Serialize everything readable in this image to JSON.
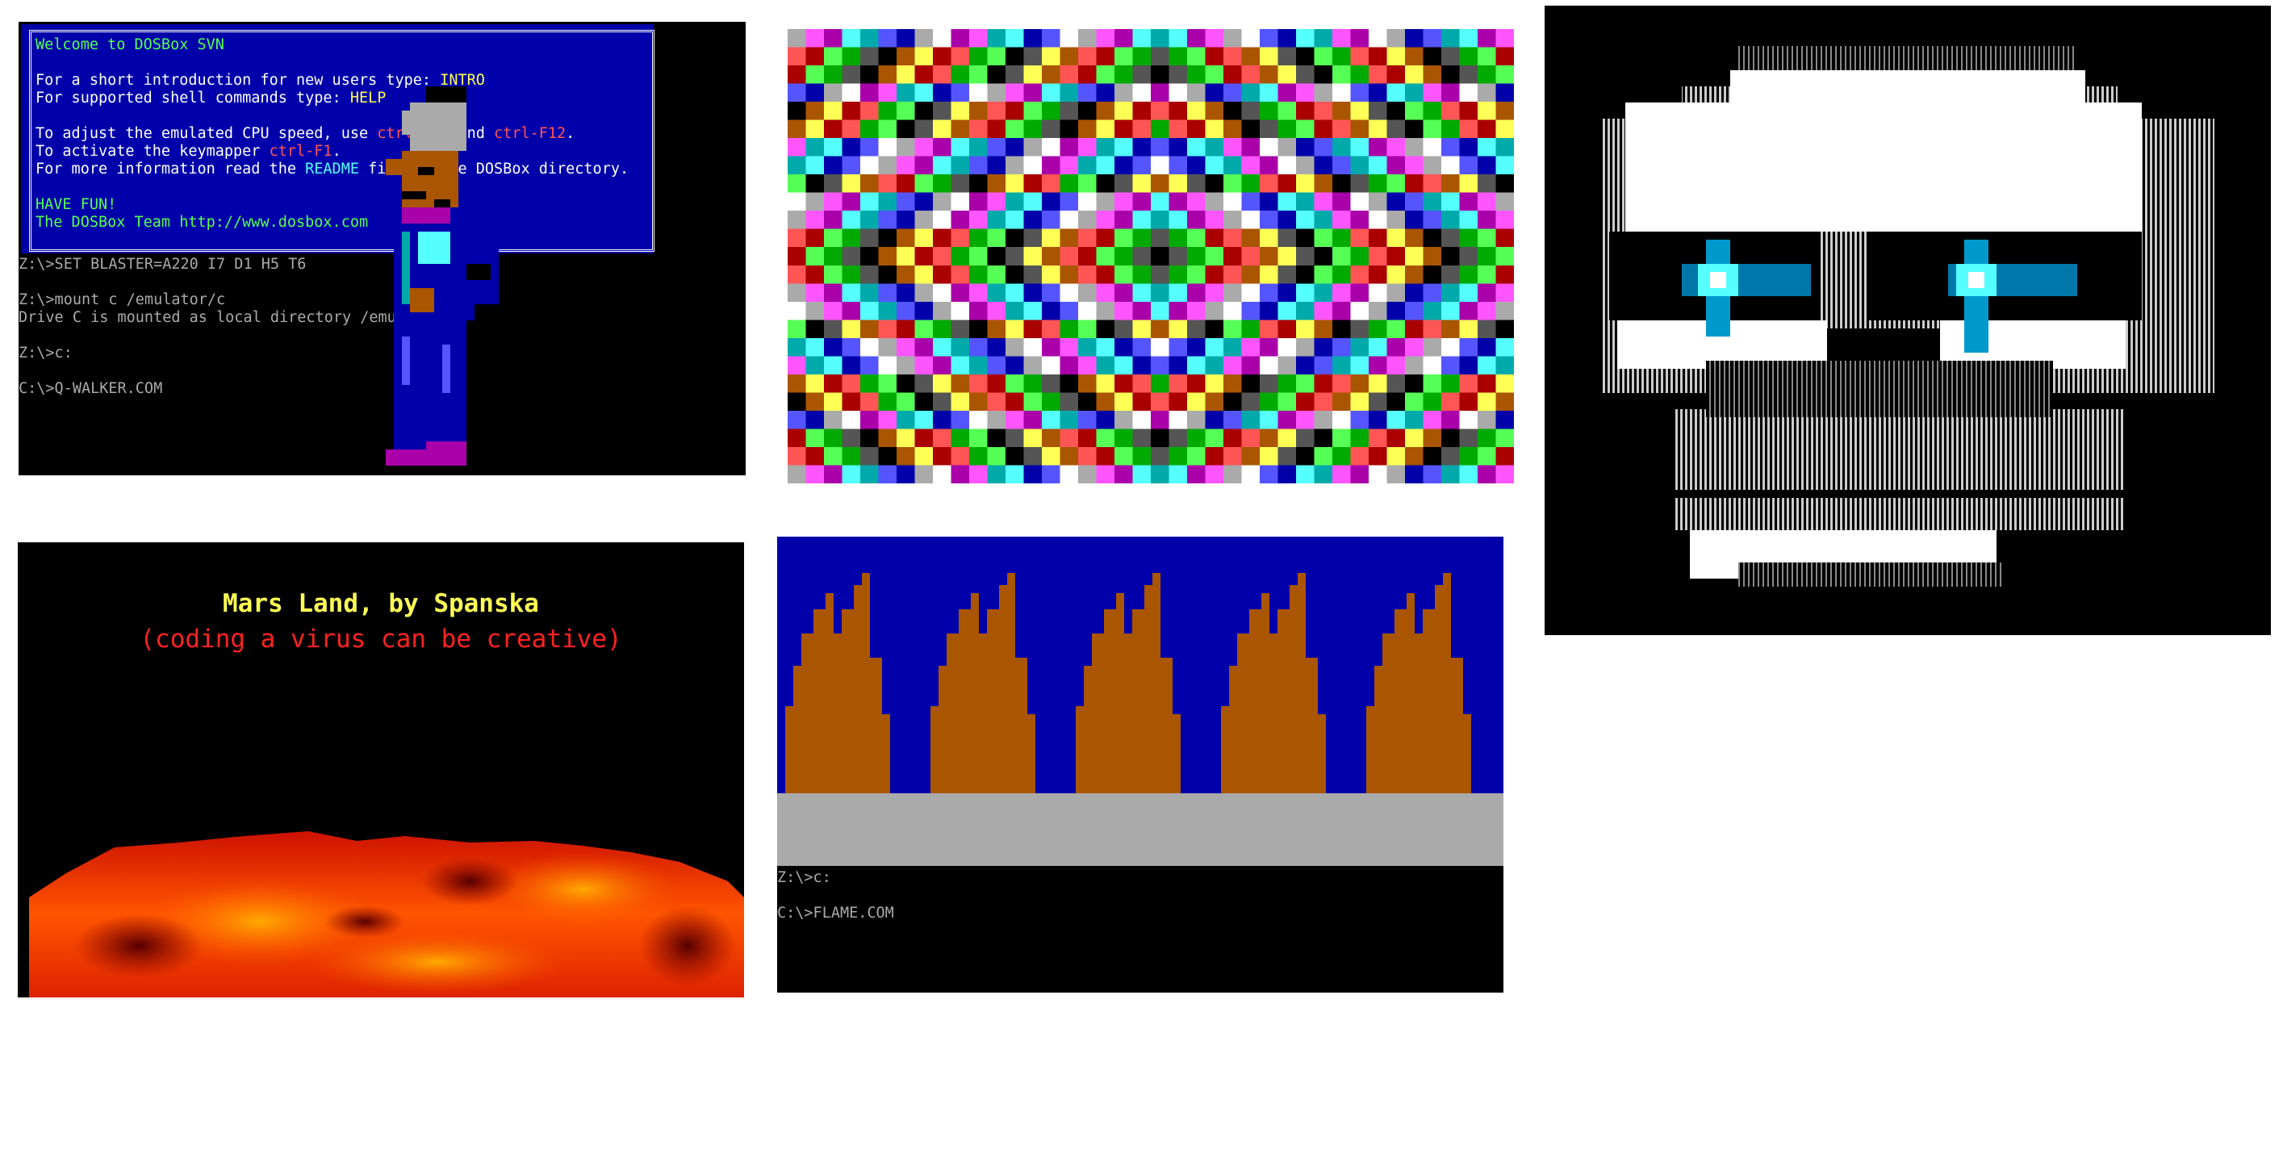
{
  "panels": {
    "dosbox": {
      "banner_lines": [
        [
          "Welcome to DOSBox SVN"
        ],
        [
          ""
        ],
        [
          "For a short introduction for new users type: ",
          "INTRO"
        ],
        [
          "For supported shell commands type: ",
          "HELP"
        ],
        [
          ""
        ],
        [
          "To adjust the emulated CPU speed, use ",
          "ctrl-F11",
          " and ",
          "ctrl-F12",
          "."
        ],
        [
          "To activate the keymapper ",
          "ctrl-F1",
          "."
        ],
        [
          "For more information read the ",
          "README",
          " file in the DOSBox directory."
        ],
        [
          ""
        ],
        [
          "HAVE FUN!"
        ],
        [
          "The DOSBox Team http://www.dosbox.com"
        ]
      ],
      "shell_lines": [
        "Z:\\>SET BLASTER=A220 I7 D1 H5 T6",
        "",
        "Z:\\>mount c /emulator/c",
        "Drive C is mounted as local directory /emulator/c/",
        "",
        "Z:\\>c:",
        "",
        "C:\\>Q-WALKER.COM"
      ]
    },
    "mars": {
      "title": "Mars Land, by Spanska",
      "subtitle": "(coding a virus can be creative)"
    },
    "flame": {
      "shell_lines": [
        "Z:\\>c:",
        "",
        "C:\\>FLAME.COM"
      ]
    }
  },
  "colors": {
    "dos_blue": "#0000aa",
    "dos_gray": "#aaaaaa",
    "flame_brown": "#aa5500",
    "bright_yellow": "#ffff55",
    "bright_red": "#ff5555"
  }
}
